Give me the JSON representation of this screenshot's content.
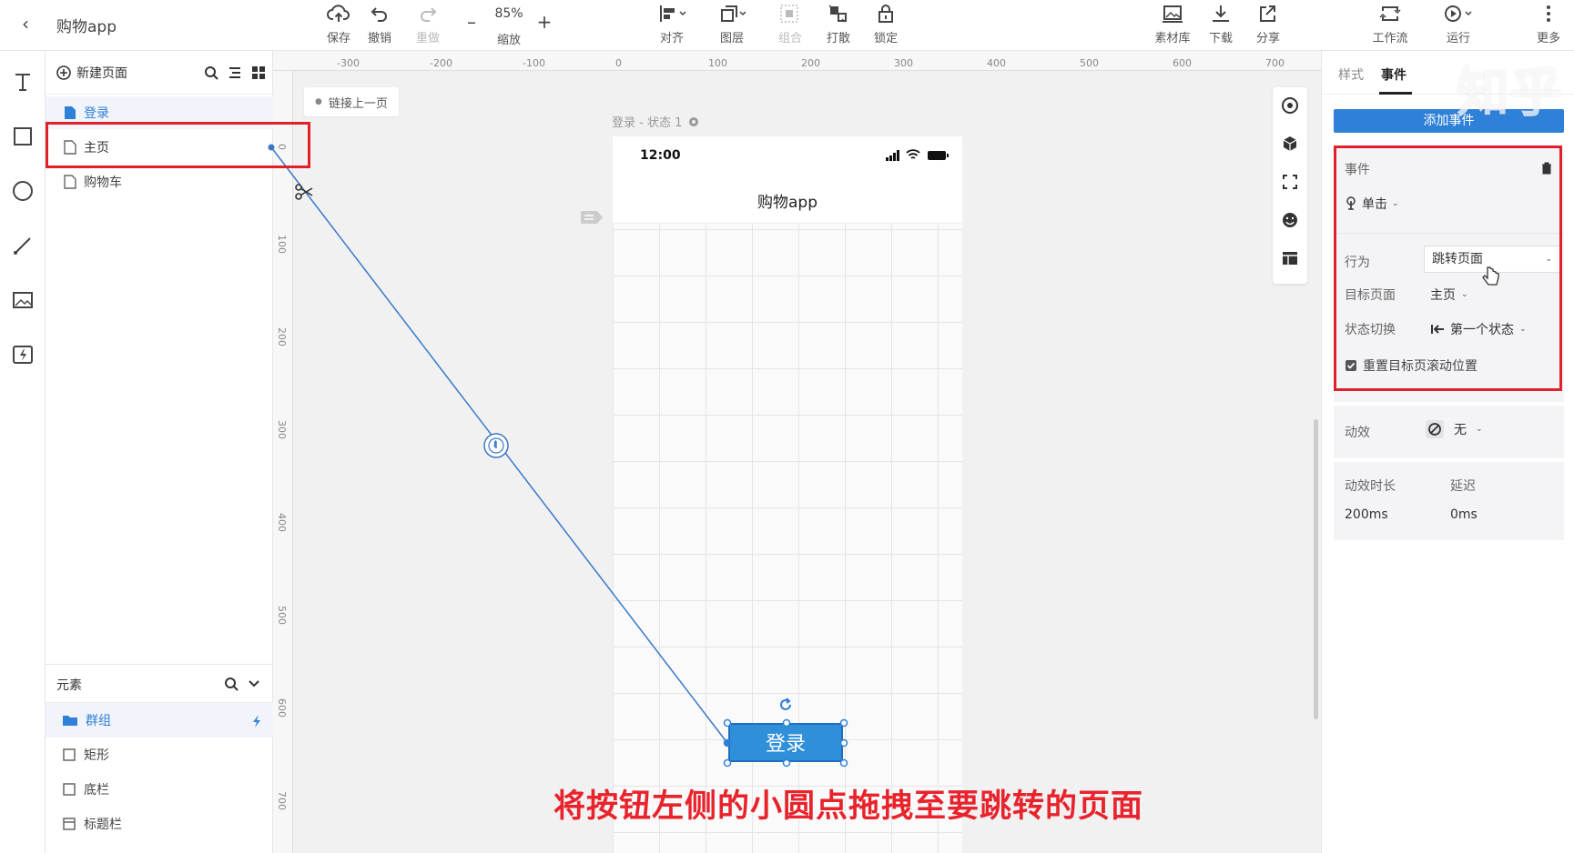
{
  "app": {
    "title": "购物app"
  },
  "toolbar": {
    "save": "保存",
    "undo": "撤销",
    "redo": "重做",
    "zoom_value": "85%",
    "zoom_label": "缩放",
    "align": "对齐",
    "layer": "图层",
    "group": "组合",
    "ungroup": "打散",
    "lock": "锁定",
    "assets": "素材库",
    "download": "下载",
    "share": "分享",
    "workflow": "工作流",
    "run": "运行",
    "more": "更多"
  },
  "pages_panel": {
    "new_page": "新建页面",
    "pages": [
      {
        "label": "登录"
      },
      {
        "label": "主页"
      },
      {
        "label": "购物车"
      }
    ]
  },
  "elements_panel": {
    "title": "元素",
    "items": [
      {
        "label": "群组"
      },
      {
        "label": "矩形"
      },
      {
        "label": "底栏"
      },
      {
        "label": "标题栏"
      }
    ]
  },
  "canvas": {
    "ruler_top": [
      "-300",
      "-200",
      "-100",
      "0",
      "100",
      "200",
      "300",
      "400",
      "500",
      "600",
      "700"
    ],
    "ruler_left": [
      "0",
      "100",
      "200",
      "300",
      "400",
      "500",
      "600",
      "700"
    ],
    "prev_link": "链接上一页",
    "state_label": "登录 - 状态 1",
    "phone_time": "12:00",
    "phone_title": "购物app",
    "button_label": "登录"
  },
  "right_panel": {
    "tab_style": "样式",
    "tab_event": "事件",
    "add_event": "添加事件",
    "event_label": "事件",
    "trigger": "单击",
    "behavior_label": "行为",
    "behavior_value": "跳转页面",
    "target_label": "目标页面",
    "target_value": "主页",
    "state_switch_label": "状态切换",
    "state_switch_value": "第一个状态",
    "reset_scroll": "重置目标页滚动位置",
    "anim_label": "动效",
    "anim_value": "无",
    "duration_label": "动效时长",
    "duration_value": "200ms",
    "delay_label": "延迟",
    "delay_value": "0ms"
  },
  "caption": "将按钮左侧的小圆点拖拽至要跳转的页面",
  "watermark": "知乎",
  "colors": {
    "accent": "#2f80d8",
    "highlight": "#e0202a"
  }
}
